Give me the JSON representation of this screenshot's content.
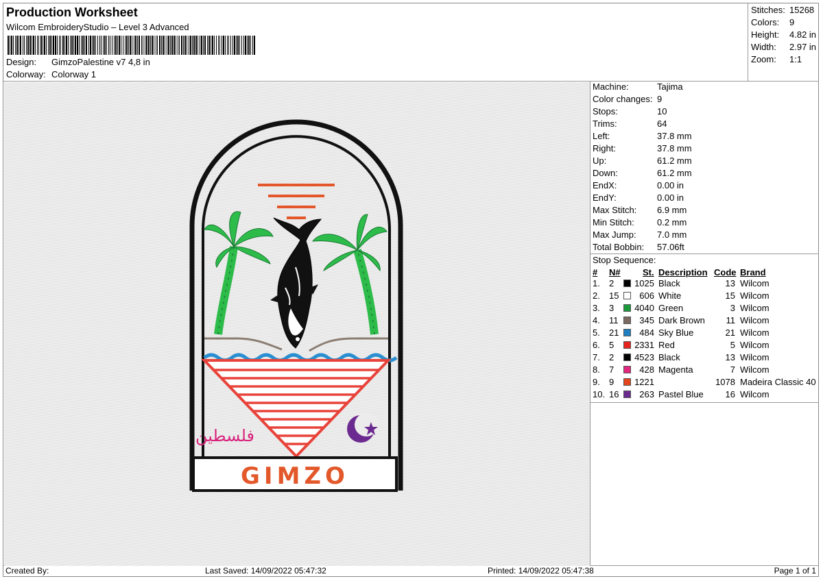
{
  "header": {
    "title": "Production Worksheet",
    "subtitle": "Wilcom EmbroideryStudio – Level 3 Advanced",
    "design_label": "Design:",
    "design_value": "GimzoPalestine v7 4,8 in",
    "colorway_label": "Colorway:",
    "colorway_value": "Colorway 1"
  },
  "stats": {
    "stitches_label": "Stitches:",
    "stitches_value": "15268",
    "colors_label": "Colors:",
    "colors_value": "9",
    "height_label": "Height:",
    "height_value": "4.82 in",
    "width_label": "Width:",
    "width_value": "2.97 in",
    "zoom_label": "Zoom:",
    "zoom_value": "1:1"
  },
  "machine": [
    {
      "label": "Machine:",
      "value": "Tajima"
    },
    {
      "label": "Color changes:",
      "value": "9"
    },
    {
      "label": "Stops:",
      "value": "10"
    },
    {
      "label": "Trims:",
      "value": "64"
    },
    {
      "label": "Left:",
      "value": "37.8 mm"
    },
    {
      "label": "Right:",
      "value": "37.8 mm"
    },
    {
      "label": "Up:",
      "value": "61.2 mm"
    },
    {
      "label": "Down:",
      "value": "61.2 mm"
    },
    {
      "label": "EndX:",
      "value": "0.00 in"
    },
    {
      "label": "EndY:",
      "value": "0.00 in"
    },
    {
      "label": "Max Stitch:",
      "value": "6.9 mm"
    },
    {
      "label": "Min Stitch:",
      "value": "0.2 mm"
    },
    {
      "label": "Max Jump:",
      "value": "7.0 mm"
    },
    {
      "label": "Total Bobbin:",
      "value": "57.06ft"
    }
  ],
  "sequence": {
    "title": "Stop Sequence:",
    "headers": {
      "num": "#",
      "n": "N#",
      "st": "St.",
      "description": "Description",
      "code": "Code",
      "brand": "Brand"
    },
    "rows": [
      {
        "idx": "1.",
        "n": "2",
        "color": "#000000",
        "st": "1025",
        "description": "Black",
        "code": "13",
        "brand": "Wilcom"
      },
      {
        "idx": "2.",
        "n": "15",
        "color": "#ffffff",
        "st": "606",
        "description": "White",
        "code": "15",
        "brand": "Wilcom"
      },
      {
        "idx": "3.",
        "n": "3",
        "color": "#1a9a3c",
        "st": "4040",
        "description": "Green",
        "code": "3",
        "brand": "Wilcom"
      },
      {
        "idx": "4.",
        "n": "11",
        "color": "#7d6a62",
        "st": "345",
        "description": "Dark Brown",
        "code": "11",
        "brand": "Wilcom"
      },
      {
        "idx": "5.",
        "n": "21",
        "color": "#1e7fc2",
        "st": "484",
        "description": "Sky Blue",
        "code": "21",
        "brand": "Wilcom"
      },
      {
        "idx": "6.",
        "n": "5",
        "color": "#e8231e",
        "st": "2331",
        "description": "Red",
        "code": "5",
        "brand": "Wilcom"
      },
      {
        "idx": "7.",
        "n": "2",
        "color": "#000000",
        "st": "4523",
        "description": "Black",
        "code": "13",
        "brand": "Wilcom"
      },
      {
        "idx": "8.",
        "n": "7",
        "color": "#e3267e",
        "st": "428",
        "description": "Magenta",
        "code": "7",
        "brand": "Wilcom"
      },
      {
        "idx": "9.",
        "n": "9",
        "color": "#e4461c",
        "st": "1221",
        "description": "",
        "code": "1078",
        "brand": "Madeira Classic 40"
      },
      {
        "idx": "10.",
        "n": "16",
        "color": "#6a2a8e",
        "st": "263",
        "description": "Pastel Blue",
        "code": "16",
        "brand": "Wilcom"
      }
    ]
  },
  "design": {
    "arabic_text": "فلسطين",
    "brand_text": "GIMZO",
    "colors": {
      "black": "#111111",
      "green": "#2dbb4a",
      "brown": "#8a7d72",
      "blue": "#2a8fd0",
      "red": "#e8433a",
      "orange": "#e3582a",
      "magenta": "#d8237c",
      "purple": "#6b2a8f"
    }
  },
  "footer": {
    "created": "Created By:",
    "saved": "Last Saved: 14/09/2022 05:47:32",
    "printed": "Printed: 14/09/2022 05:47:38",
    "page": "Page 1 of 1"
  }
}
